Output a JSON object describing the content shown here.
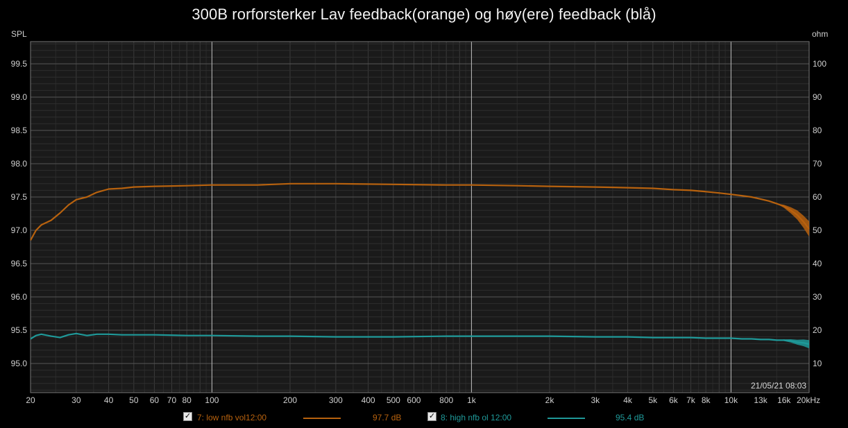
{
  "title": "300B rorforsterker Lav feedback(orange) og høy(ere) feedback (blå)",
  "left_axis_label": "SPL",
  "right_axis_label": "ohm",
  "timestamp": "21/05/21 08:03",
  "colors": {
    "background": "#000000",
    "plot_bg": "#1a1a1a",
    "orange": "#b8620e",
    "teal": "#1f9a9a"
  },
  "legend": [
    {
      "checked": "✓",
      "label": "7: low nfb vol12:00",
      "value": "97.7 dB",
      "color": "#b8620e"
    },
    {
      "checked": "✓",
      "label": "8: high nfb ol 12:00",
      "value": "95.4 dB",
      "color": "#1f9a9a"
    }
  ],
  "chart_data": {
    "type": "line",
    "x_scale": "log",
    "xlim": [
      20,
      20000
    ],
    "ylim": [
      94.6,
      97.3
    ],
    "y_right_lim": [
      6,
      108
    ],
    "grid": true,
    "x_ticks": [
      {
        "v": 20,
        "label": "20"
      },
      {
        "v": 30,
        "label": "30"
      },
      {
        "v": 40,
        "label": "40"
      },
      {
        "v": 50,
        "label": "50"
      },
      {
        "v": 60,
        "label": "60"
      },
      {
        "v": 70,
        "label": "70"
      },
      {
        "v": 80,
        "label": "80"
      },
      {
        "v": 100,
        "label": "100"
      },
      {
        "v": 200,
        "label": "200"
      },
      {
        "v": 300,
        "label": "300"
      },
      {
        "v": 400,
        "label": "400"
      },
      {
        "v": 500,
        "label": "500"
      },
      {
        "v": 600,
        "label": "600"
      },
      {
        "v": 800,
        "label": "800"
      },
      {
        "v": 1000,
        "label": "1k"
      },
      {
        "v": 2000,
        "label": "2k"
      },
      {
        "v": 3000,
        "label": "3k"
      },
      {
        "v": 4000,
        "label": "4k"
      },
      {
        "v": 5000,
        "label": "5k"
      },
      {
        "v": 6000,
        "label": "6k"
      },
      {
        "v": 7000,
        "label": "7k"
      },
      {
        "v": 8000,
        "label": "8k"
      },
      {
        "v": 10000,
        "label": "10k"
      },
      {
        "v": 13000,
        "label": "13k"
      },
      {
        "v": 16000,
        "label": "16k"
      },
      {
        "v": 20000,
        "label": "20kHz"
      }
    ],
    "y_ticks": [
      {
        "v": 95.0,
        "label": "95.0"
      },
      {
        "v": 95.5,
        "label": "95.5"
      },
      {
        "v": 96.0,
        "label": "96.0"
      },
      {
        "v": 96.5,
        "label": "96.5"
      },
      {
        "v": 97.0,
        "label": "97.0"
      },
      {
        "v": 97.5,
        "label": "97.5"
      },
      {
        "v": 98.0,
        "label": "98.0"
      },
      {
        "v": 98.5,
        "label": "98.5"
      },
      {
        "v": 99.0,
        "label": "99.0"
      },
      {
        "v": 99.5,
        "label": "99.5"
      }
    ],
    "y_right_ticks": [
      {
        "v": 10,
        "label": "10"
      },
      {
        "v": 20,
        "label": "20"
      },
      {
        "v": 30,
        "label": "30"
      },
      {
        "v": 40,
        "label": "40"
      },
      {
        "v": 50,
        "label": "50"
      },
      {
        "v": 60,
        "label": "60"
      },
      {
        "v": 70,
        "label": "70"
      },
      {
        "v": 80,
        "label": "80"
      },
      {
        "v": 90,
        "label": "90"
      },
      {
        "v": 100,
        "label": "100"
      }
    ],
    "series": [
      {
        "name": "7: low nfb vol12:00",
        "color": "#b8620e",
        "x": [
          20,
          21,
          22,
          24,
          26,
          28,
          30,
          33,
          36,
          40,
          45,
          50,
          60,
          80,
          100,
          150,
          200,
          300,
          500,
          800,
          1000,
          1500,
          2000,
          3000,
          4000,
          5000,
          6000,
          7000,
          8000,
          9000,
          10000,
          11000,
          12000,
          13000,
          14000,
          15000,
          16000,
          17000,
          18000,
          19000,
          20000
        ],
        "y": [
          96.85,
          97.0,
          97.08,
          97.15,
          97.26,
          97.38,
          97.46,
          97.5,
          97.57,
          97.62,
          97.63,
          97.65,
          97.66,
          97.67,
          97.68,
          97.68,
          97.7,
          97.7,
          97.69,
          97.68,
          97.68,
          97.67,
          97.66,
          97.65,
          97.64,
          97.63,
          97.61,
          97.6,
          97.58,
          97.56,
          97.54,
          97.52,
          97.5,
          97.47,
          97.44,
          97.4,
          97.36,
          97.3,
          97.23,
          97.13,
          97.02
        ]
      },
      {
        "name": "8: high nfb ol 12:00",
        "color": "#1f9a9a",
        "x": [
          20,
          21,
          22,
          24,
          26,
          28,
          30,
          33,
          36,
          40,
          45,
          50,
          60,
          80,
          100,
          150,
          200,
          300,
          500,
          800,
          1000,
          1500,
          2000,
          3000,
          4000,
          5000,
          6000,
          7000,
          8000,
          9000,
          10000,
          11000,
          12000,
          13000,
          14000,
          15000,
          16000,
          17000,
          18000,
          19000,
          20000
        ],
        "y": [
          95.37,
          95.42,
          95.44,
          95.41,
          95.39,
          95.43,
          95.45,
          95.42,
          95.44,
          95.44,
          95.43,
          95.43,
          95.43,
          95.42,
          95.42,
          95.41,
          95.41,
          95.4,
          95.4,
          95.41,
          95.41,
          95.41,
          95.41,
          95.4,
          95.4,
          95.39,
          95.39,
          95.39,
          95.38,
          95.38,
          95.38,
          95.37,
          95.37,
          95.36,
          95.36,
          95.35,
          95.35,
          95.34,
          95.32,
          95.31,
          95.29
        ]
      }
    ]
  }
}
